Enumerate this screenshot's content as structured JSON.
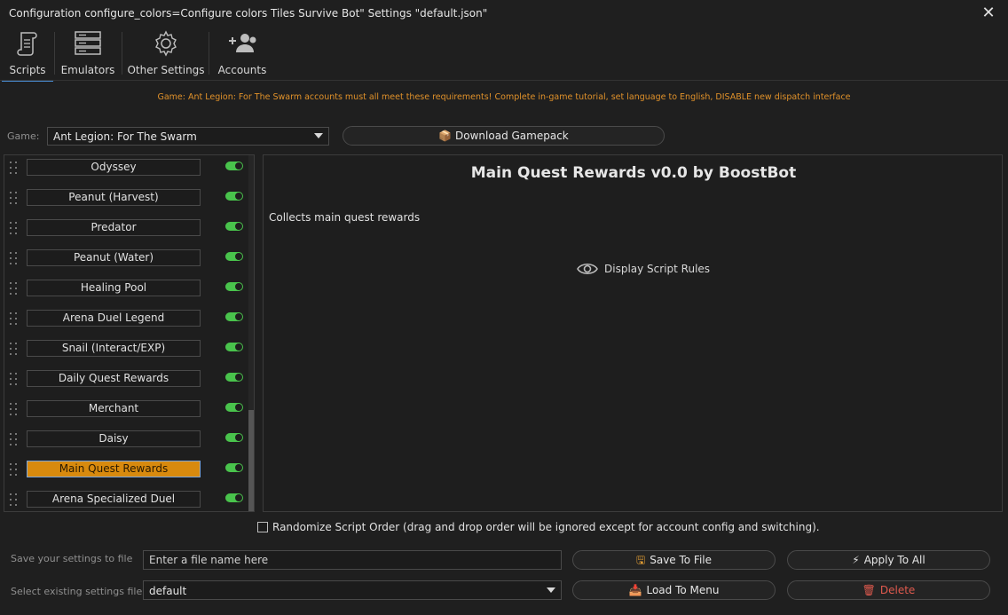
{
  "window": {
    "title": "Configuration configure_colors=Configure colors Tiles Survive Bot\" Settings \"default.json\"",
    "close_glyph": "✕"
  },
  "tabs": [
    {
      "label": "Scripts",
      "icon": "scroll-icon",
      "active": true
    },
    {
      "label": "Emulators",
      "icon": "server-stack-icon",
      "active": false
    },
    {
      "label": "Other Settings",
      "icon": "gear-icon",
      "active": false
    },
    {
      "label": "Accounts",
      "icon": "users-add-icon",
      "active": false
    }
  ],
  "notice": "Game: Ant Legion: For The Swarm accounts must all meet these requirements! Complete in-game tutorial, set language to English, DISABLE new dispatch interface",
  "game": {
    "label": "Game:",
    "selected": "Ant Legion: For The Swarm",
    "download_label": "Download Gamepack",
    "download_icon": "📦"
  },
  "scripts": [
    {
      "name": "Odyssey",
      "enabled": true,
      "selected": false
    },
    {
      "name": "Peanut (Harvest)",
      "enabled": true,
      "selected": false
    },
    {
      "name": "Predator",
      "enabled": true,
      "selected": false
    },
    {
      "name": "Peanut (Water)",
      "enabled": true,
      "selected": false
    },
    {
      "name": "Healing Pool",
      "enabled": true,
      "selected": false
    },
    {
      "name": "Arena Duel Legend",
      "enabled": true,
      "selected": false
    },
    {
      "name": "Snail (Interact/EXP)",
      "enabled": true,
      "selected": false
    },
    {
      "name": "Daily Quest Rewards",
      "enabled": true,
      "selected": false
    },
    {
      "name": "Merchant",
      "enabled": true,
      "selected": false
    },
    {
      "name": "Daisy",
      "enabled": true,
      "selected": false
    },
    {
      "name": "Main Quest Rewards",
      "enabled": true,
      "selected": true
    },
    {
      "name": "Arena Specialized Duel",
      "enabled": true,
      "selected": false
    }
  ],
  "detail": {
    "title": "Main Quest Rewards v0.0 by BoostBot",
    "description": "Collects main quest rewards",
    "rules_link": "Display Script Rules"
  },
  "randomize": {
    "label": "Randomize Script Order (drag and drop order will be ignored except for account config and switching).",
    "checked": false
  },
  "bottom": {
    "save_label": "Save your settings to file",
    "file_placeholder": "Enter a file name here",
    "select_label": "Select existing settings file",
    "selected_file": "default",
    "save_button": "Save To File",
    "apply_button": "Apply To All",
    "load_button": "Load To Menu",
    "delete_button": "Delete",
    "save_icon": "🖫",
    "apply_icon": "⚡",
    "load_icon": "📥",
    "delete_icon": "🗑"
  },
  "colors": {
    "accent_selected": "#d88a0e",
    "toggle_on": "#49c34c",
    "notice": "#e0912a",
    "delete": "#e05a4e",
    "tab_underline": "#4a90d9"
  }
}
